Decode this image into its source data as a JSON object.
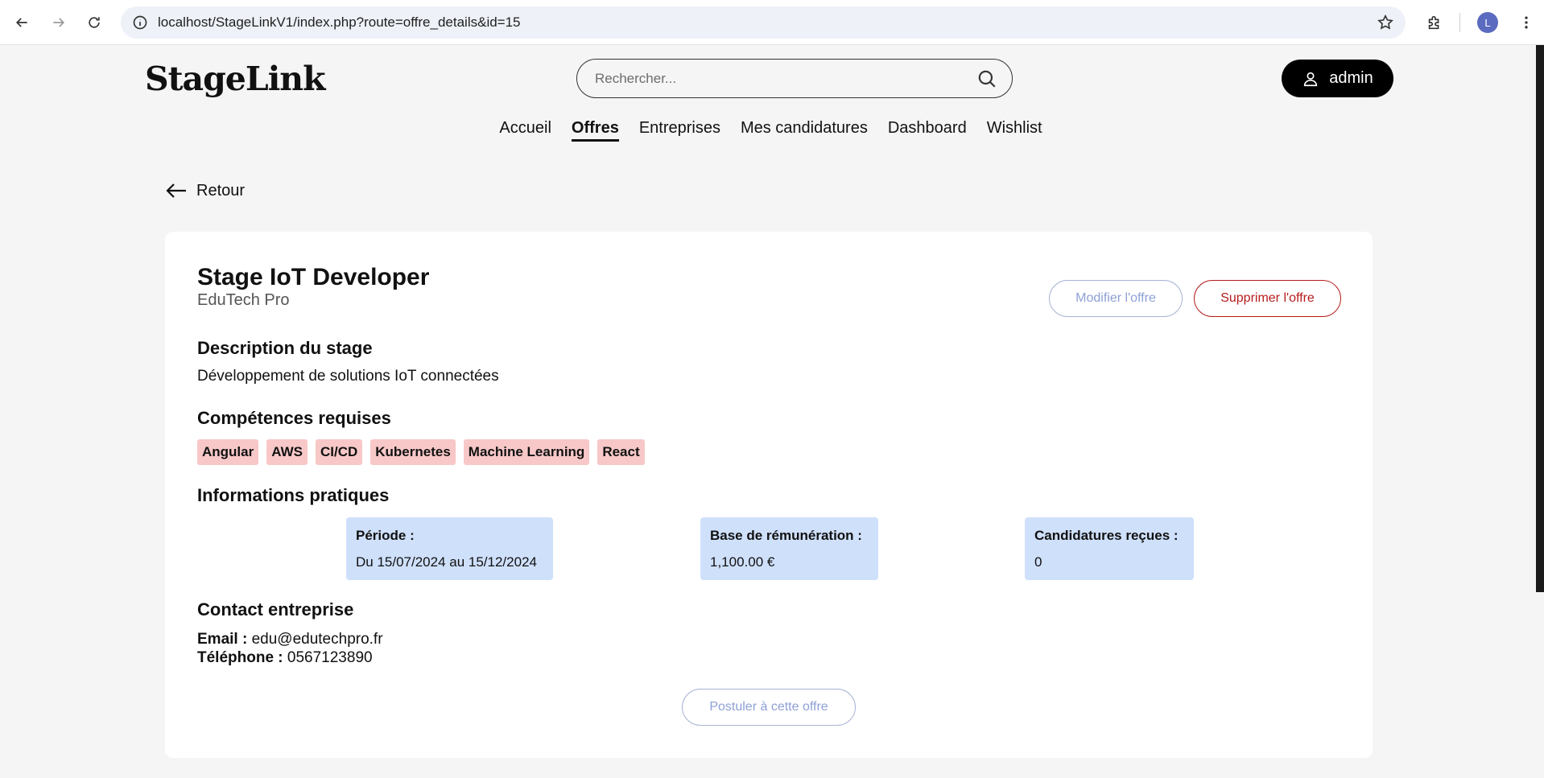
{
  "browser": {
    "url": "localhost/StageLinkV1/index.php?route=offre_details&id=15",
    "profile_initial": "L"
  },
  "header": {
    "logo": "StageLink",
    "search_placeholder": "Rechercher...",
    "user_label": "admin"
  },
  "nav": {
    "items": [
      {
        "label": "Accueil",
        "active": false
      },
      {
        "label": "Offres",
        "active": true
      },
      {
        "label": "Entreprises",
        "active": false
      },
      {
        "label": "Mes candidatures",
        "active": false
      },
      {
        "label": "Dashboard",
        "active": false
      },
      {
        "label": "Wishlist",
        "active": false
      }
    ]
  },
  "back_label": "Retour",
  "offer": {
    "title": "Stage IoT Developer",
    "company": "EduTech Pro",
    "edit_label": "Modifier l'offre",
    "delete_label": "Supprimer l'offre",
    "description_title": "Description du stage",
    "description": "Développement de solutions IoT connectées",
    "skills_title": "Compétences requises",
    "skills": [
      "Angular",
      "AWS",
      "CI/CD",
      "Kubernetes",
      "Machine Learning",
      "React"
    ],
    "info_title": "Informations pratiques",
    "info": {
      "period_label": "Période :",
      "period_value": "Du 15/07/2024 au 15/12/2024",
      "salary_label": "Base de rémunération :",
      "salary_value": "1,100.00 €",
      "applications_label": "Candidatures reçues :",
      "applications_value": "0"
    },
    "contact_title": "Contact entreprise",
    "contact": {
      "email_label": "Email :",
      "email_value": "edu@edutechpro.fr",
      "phone_label": "Téléphone :",
      "phone_value": "0567123890"
    },
    "apply_label": "Postuler à cette offre"
  },
  "colors": {
    "skill_tag_bg": "#f8c8c8",
    "info_box_bg": "#cfe0fb",
    "danger": "#b71c1c",
    "muted_button": "#8ea0d6"
  }
}
